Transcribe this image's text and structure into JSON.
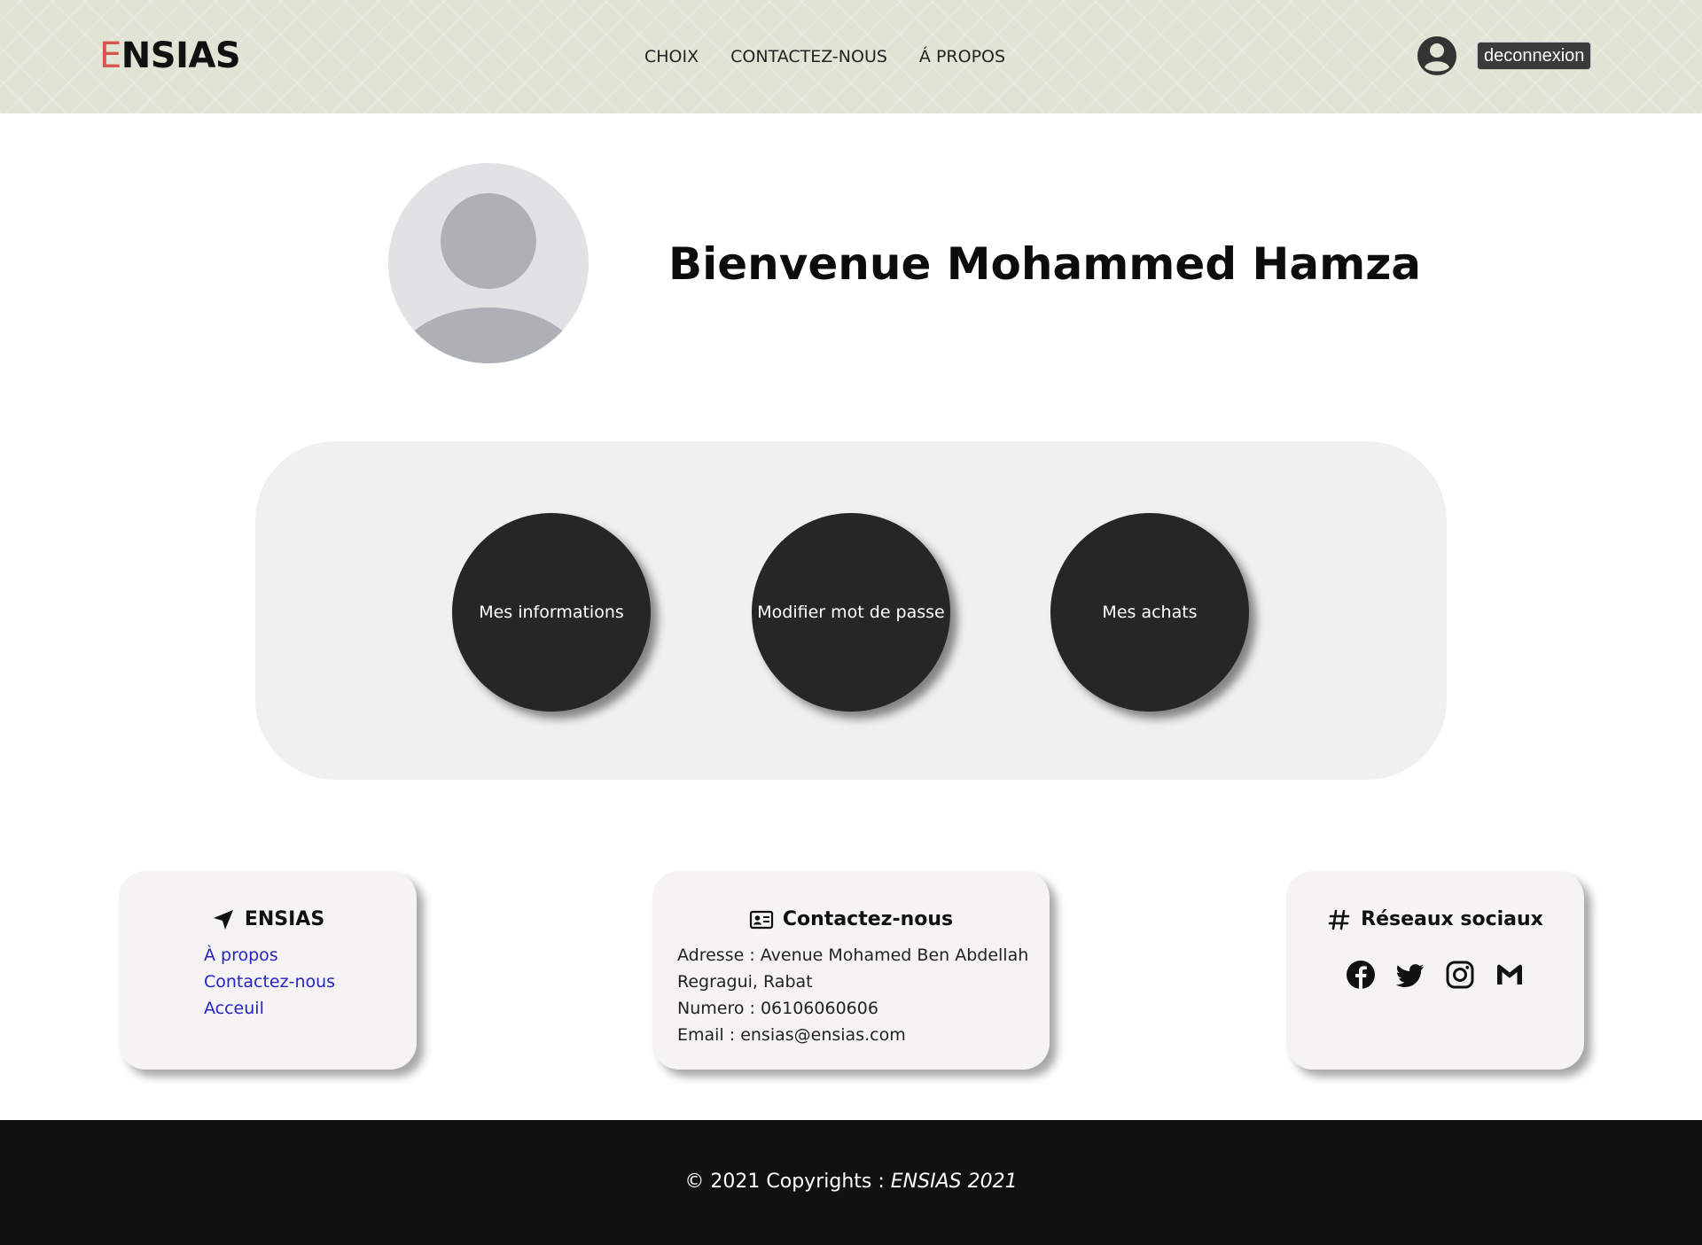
{
  "header": {
    "logo_first": "E",
    "logo_rest": "NSIAS",
    "nav": [
      "CHOIX",
      "CONTACTEZ-NOUS",
      "Á PROPOS"
    ],
    "user_icon": "user-circle-icon",
    "logout_label": "deconnexion",
    "accent_color": "#d9534f"
  },
  "welcome": {
    "title": "Bienvenue Mohammed Hamza",
    "avatar_icon": "default-avatar-icon"
  },
  "actions": {
    "items": [
      "Mes informations",
      "Modifier mot de passe",
      "Mes achats"
    ]
  },
  "cards": {
    "ensias": {
      "title": "ENSIAS",
      "icon": "location-arrow-icon",
      "links": [
        "À propos",
        "Contactez-nous",
        "Acceuil"
      ],
      "link_color": "#2323c9"
    },
    "contact": {
      "title": "Contactez-nous",
      "icon": "address-card-icon",
      "lines": [
        "Adresse : Avenue Mohamed Ben Abdellah",
        "Regragui, Rabat",
        "Numero : 06106060606",
        "Email : ensias@ensias.com"
      ]
    },
    "social": {
      "title": "Réseaux sociaux",
      "icon": "hashtag-icon",
      "icons": [
        "facebook-icon",
        "twitter-icon",
        "instagram-icon",
        "gmail-icon"
      ]
    }
  },
  "footer": {
    "copyright": "© 2021 Copyrights : ",
    "brand": "ENSIAS 2021"
  }
}
